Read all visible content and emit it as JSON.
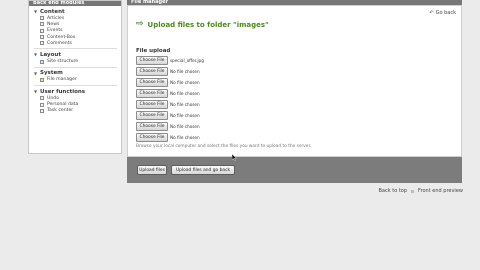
{
  "sidebar": {
    "title": "Back end modules",
    "groups": [
      {
        "label": "Content",
        "items": [
          {
            "label": "Articles",
            "icon": "articles-icon"
          },
          {
            "label": "News",
            "icon": "news-icon"
          },
          {
            "label": "Events",
            "icon": "events-icon"
          },
          {
            "label": "Content-Box",
            "icon": "content-box-icon"
          },
          {
            "label": "Comments",
            "icon": "comments-icon"
          }
        ]
      },
      {
        "label": "Layout",
        "items": [
          {
            "label": "Site structure",
            "icon": "site-structure-icon"
          }
        ]
      },
      {
        "label": "System",
        "items": [
          {
            "label": "File manager",
            "icon": "file-manager-icon"
          }
        ]
      },
      {
        "label": "User functions",
        "items": [
          {
            "label": "Undo",
            "icon": "undo-icon"
          },
          {
            "label": "Personal data",
            "icon": "personal-data-icon"
          },
          {
            "label": "Task center",
            "icon": "task-center-icon"
          }
        ]
      }
    ]
  },
  "main": {
    "title": "File manager",
    "go_back": "Go back",
    "heading": "Upload files to folder \"images\"",
    "file_upload_label": "File upload",
    "choose_label": "Choose File",
    "files": [
      "special_offer.jpg",
      "No file chosen",
      "No file chosen",
      "No file chosen",
      "No file chosen",
      "No file chosen",
      "No file chosen",
      "No file chosen"
    ],
    "hint": "Browse your local computer and select the files you want to upload to the server.",
    "upload_button": "Upload files",
    "upload_back_button": "Upload files and go back"
  },
  "footer": {
    "back_to_top": "Back to top",
    "front_preview": "Front end preview"
  },
  "colors": {
    "accent": "#4a8a1e",
    "header_bar": "#777777",
    "toolbar": "#7c7c7c"
  }
}
